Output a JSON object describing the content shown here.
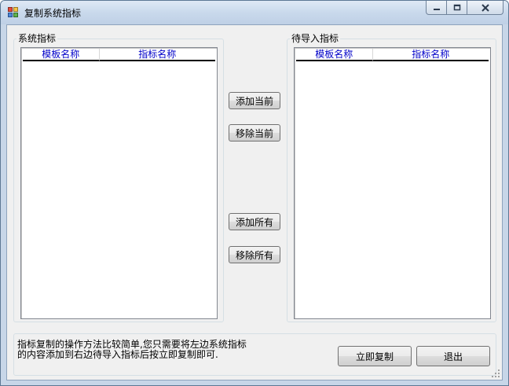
{
  "window": {
    "title": "复制系统指标",
    "icon": "app-grid-icon"
  },
  "caption_buttons": {
    "minimize": "minimize-icon",
    "maximize": "maximize-icon",
    "close": "close-icon"
  },
  "left_group": {
    "title": "系统指标",
    "columns": [
      "模板名称",
      "指标名称"
    ],
    "rows": []
  },
  "right_group": {
    "title": "待导入指标",
    "columns": [
      "模板名称",
      "指标名称"
    ],
    "rows": []
  },
  "buttons": {
    "add_current": "添加当前",
    "remove_current": "移除当前",
    "add_all": "添加所有",
    "remove_all": "移除所有",
    "copy_now": "立即复制",
    "exit": "退出"
  },
  "hint": {
    "line1": "指标复制的操作方法比较简单,您只需要将左边系统指标",
    "line2": "的内容添加到右边待导入指标后按立即复制即可."
  },
  "colors": {
    "header_text": "#0000c8",
    "title_bar": "#c9d9ec"
  }
}
